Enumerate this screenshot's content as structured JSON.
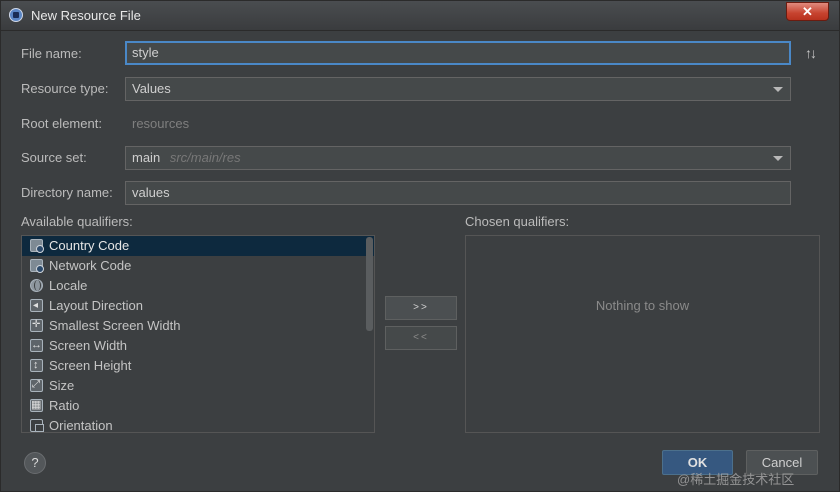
{
  "window": {
    "title": "New Resource File",
    "close_glyph": "✕"
  },
  "form": {
    "file_name_label": "File name:",
    "file_name_value": "style",
    "sort_glyph": "↑↓",
    "resource_type_label": "Resource type:",
    "resource_type_value": "Values",
    "root_element_label": "Root element:",
    "root_element_value": "resources",
    "source_set_label": "Source set:",
    "source_set_value": "main",
    "source_set_path": "src/main/res",
    "directory_name_label": "Directory name:",
    "directory_name_value": "values"
  },
  "qualifiers": {
    "available_label": "Available qualifiers:",
    "chosen_label": "Chosen qualifiers:",
    "empty_text": "Nothing to show",
    "add_label": ">>",
    "remove_label": "<<",
    "items": [
      {
        "label": "Country Code",
        "icon": "country-code-icon"
      },
      {
        "label": "Network Code",
        "icon": "network-code-icon"
      },
      {
        "label": "Locale",
        "icon": "globe-icon"
      },
      {
        "label": "Layout Direction",
        "icon": "layout-direction-icon"
      },
      {
        "label": "Smallest Screen Width",
        "icon": "smallest-width-icon"
      },
      {
        "label": "Screen Width",
        "icon": "screen-width-icon"
      },
      {
        "label": "Screen Height",
        "icon": "screen-height-icon"
      },
      {
        "label": "Size",
        "icon": "size-icon"
      },
      {
        "label": "Ratio",
        "icon": "ratio-icon"
      },
      {
        "label": "Orientation",
        "icon": "orientation-icon"
      }
    ]
  },
  "footer": {
    "help_label": "?",
    "ok_label": "OK",
    "cancel_label": "Cancel",
    "watermark": "@稀土掘金技术社区"
  }
}
